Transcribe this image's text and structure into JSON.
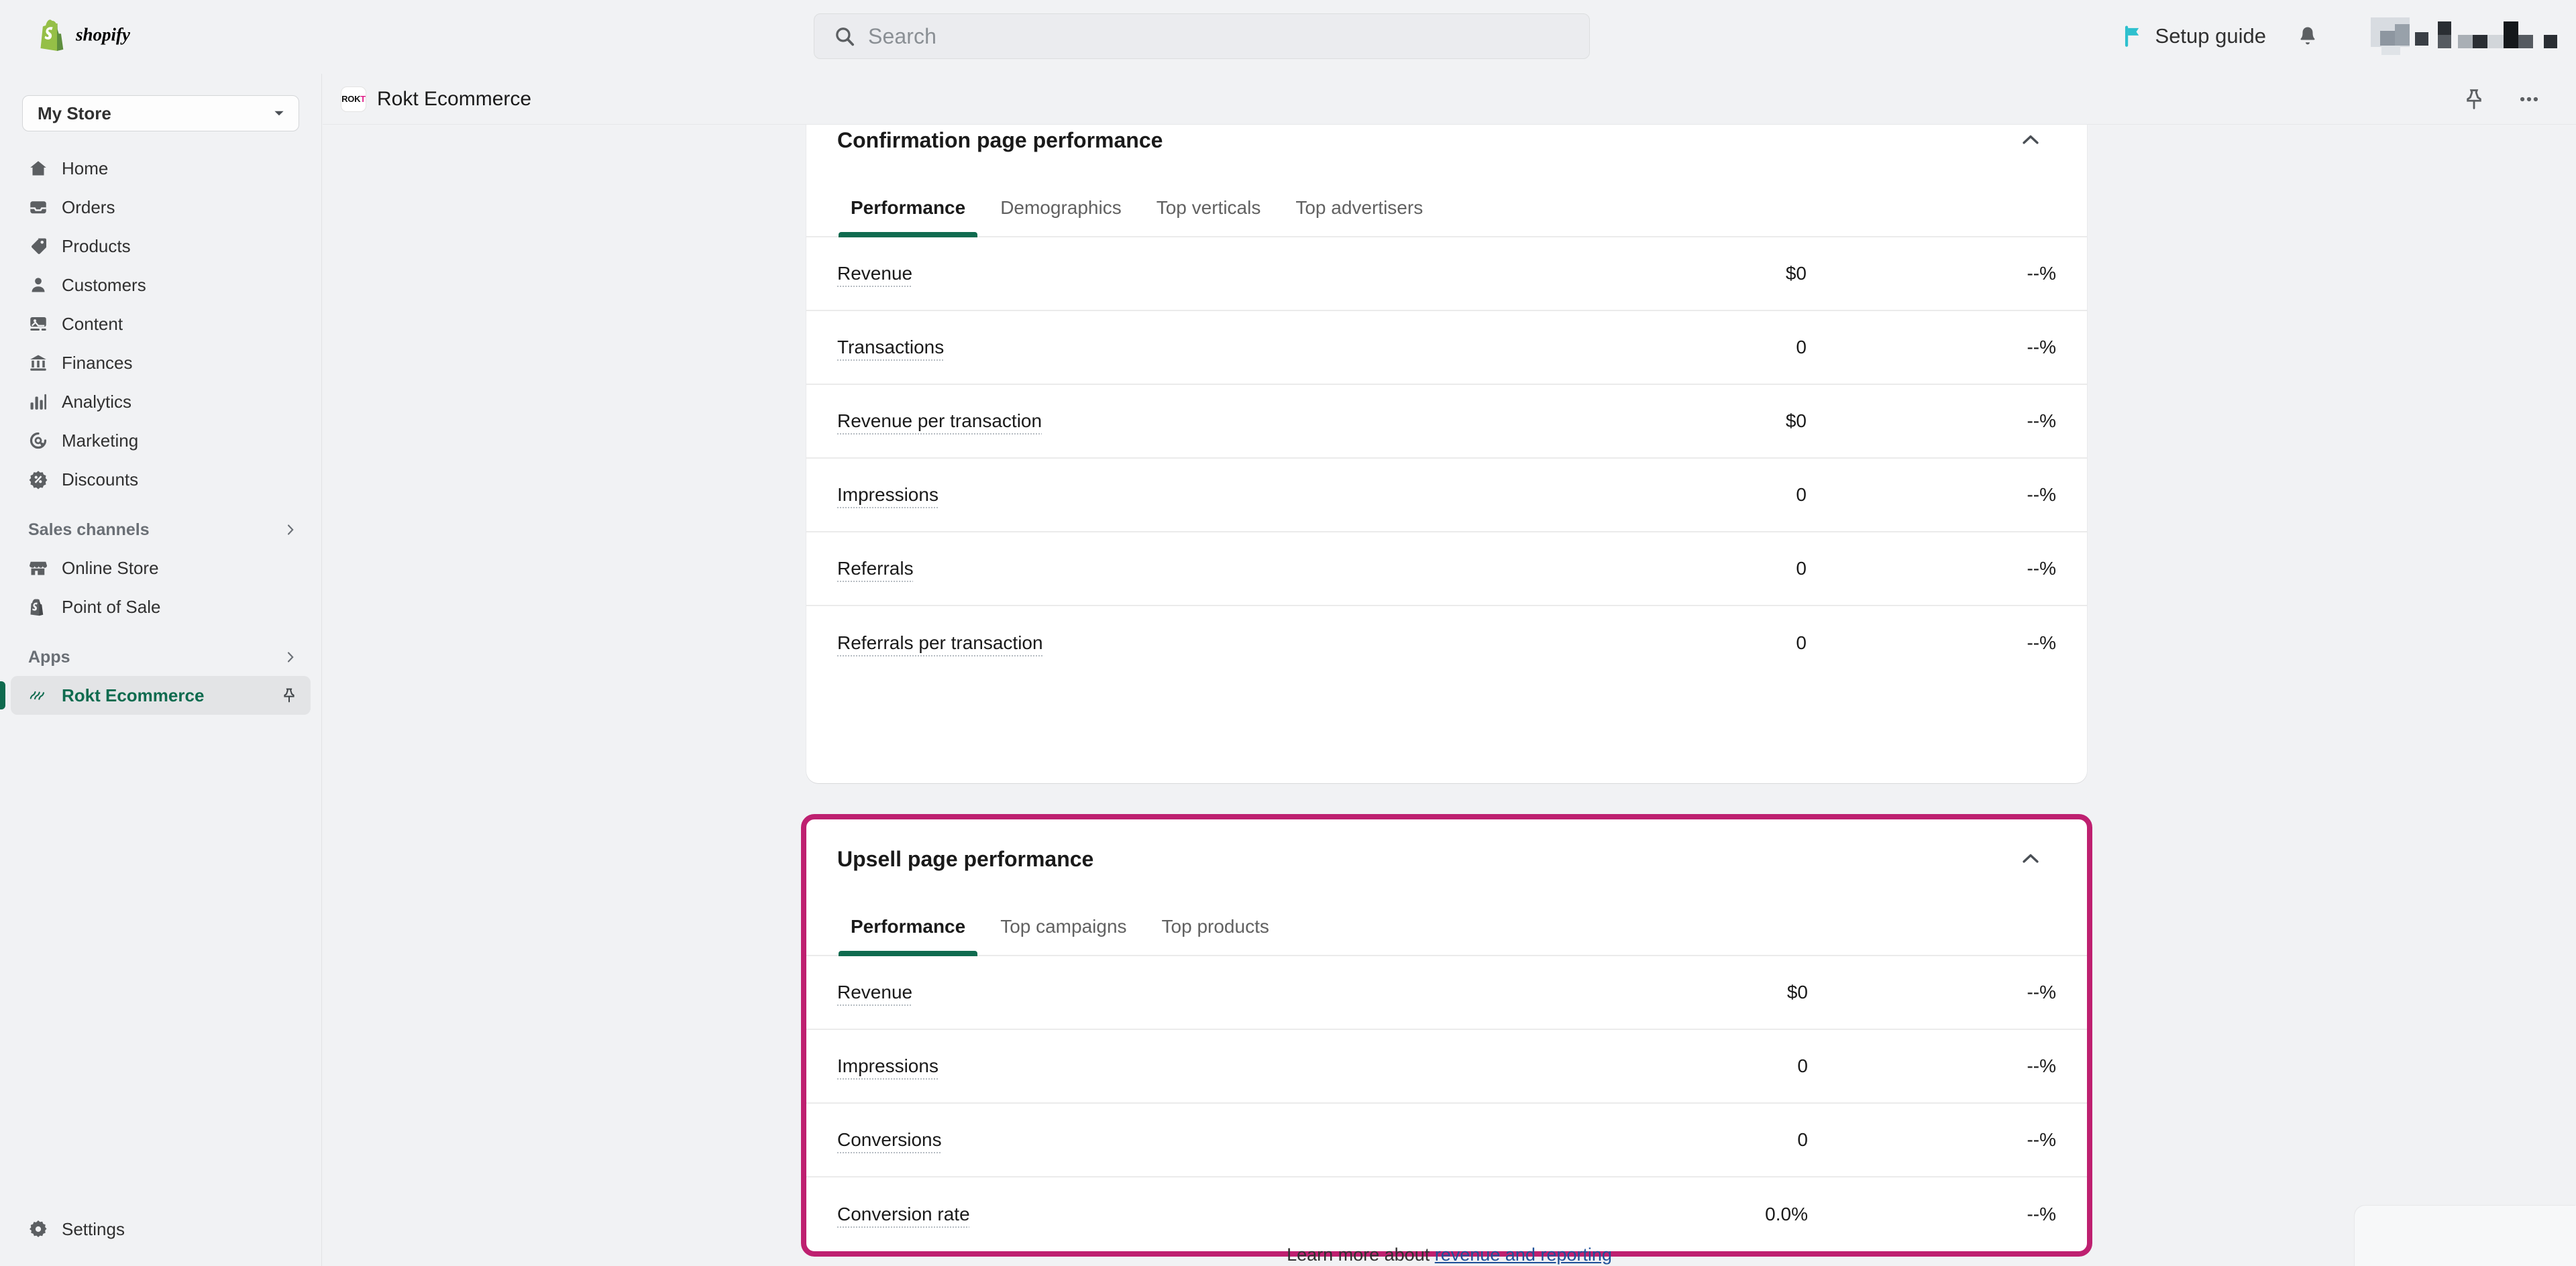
{
  "topbar": {
    "logo_text": "shopify",
    "search": {
      "placeholder": "Search",
      "value": "",
      "icon": "search-icon"
    },
    "setup_guide": {
      "label": "Setup guide",
      "icon": "flag-icon",
      "color": "#2ec0ce"
    },
    "notifications_icon": "bell-icon",
    "store_chip": {
      "label": "",
      "note": "redacted"
    }
  },
  "sidebar": {
    "store_switcher": {
      "label": "My Store",
      "icon": "chevron-down-icon"
    },
    "items": [
      {
        "label": "Home",
        "icon": "home-icon"
      },
      {
        "label": "Orders",
        "icon": "orders-icon"
      },
      {
        "label": "Products",
        "icon": "products-tag-icon"
      },
      {
        "label": "Customers",
        "icon": "customers-person-icon"
      },
      {
        "label": "Content",
        "icon": "content-image-icon"
      },
      {
        "label": "Finances",
        "icon": "finances-bank-icon"
      },
      {
        "label": "Analytics",
        "icon": "analytics-bars-icon"
      },
      {
        "label": "Marketing",
        "icon": "marketing-target-icon"
      },
      {
        "label": "Discounts",
        "icon": "discounts-badge-icon"
      }
    ],
    "sections": [
      {
        "label": "Sales channels",
        "icon": "chevron-right-icon"
      },
      {
        "label": "Apps",
        "icon": "chevron-right-icon"
      }
    ],
    "sales_channels": [
      {
        "label": "Online Store",
        "icon": "storefront-icon"
      },
      {
        "label": "Point of Sale",
        "icon": "pos-bag-icon"
      }
    ],
    "apps": [
      {
        "label": "Rokt Ecommerce",
        "icon": "rokt-squiggle-icon",
        "active": true,
        "pin_icon": "pin-icon"
      }
    ],
    "settings": {
      "label": "Settings",
      "icon": "gear-icon"
    }
  },
  "appbar": {
    "app_name": "Rokt Ecommerce",
    "logo_word": "ROK",
    "logo_word_accent": "T",
    "pin_icon": "pin-icon",
    "more_icon": "more-horizontal-icon"
  },
  "colors": {
    "accent_green": "#0f6b4f",
    "highlight_magenta": "#be2070",
    "link_blue": "#1f5199",
    "teal": "#2ec0ce"
  },
  "cards": [
    {
      "id": "confirmation",
      "title": "Confirmation page performance",
      "collapse_icon": "chevron-up-icon",
      "tabs": [
        {
          "label": "Performance",
          "active": true
        },
        {
          "label": "Demographics",
          "active": false
        },
        {
          "label": "Top verticals",
          "active": false
        },
        {
          "label": "Top advertisers",
          "active": false
        }
      ],
      "metrics": [
        {
          "label": "Revenue",
          "value": "$0",
          "delta": "--%"
        },
        {
          "label": "Transactions",
          "value": "0",
          "delta": "--%"
        },
        {
          "label": "Revenue per transaction",
          "value": "$0",
          "delta": "--%"
        },
        {
          "label": "Impressions",
          "value": "0",
          "delta": "--%"
        },
        {
          "label": "Referrals",
          "value": "0",
          "delta": "--%"
        },
        {
          "label": "Referrals per transaction",
          "value": "0",
          "delta": "--%"
        }
      ]
    },
    {
      "id": "upsell",
      "title": "Upsell page performance",
      "collapse_icon": "chevron-up-icon",
      "highlighted": true,
      "tabs": [
        {
          "label": "Performance",
          "active": true
        },
        {
          "label": "Top campaigns",
          "active": false
        },
        {
          "label": "Top products",
          "active": false
        }
      ],
      "metrics": [
        {
          "label": "Revenue",
          "value": "$0",
          "delta": "--%"
        },
        {
          "label": "Impressions",
          "value": "0",
          "delta": "--%"
        },
        {
          "label": "Conversions",
          "value": "0",
          "delta": "--%"
        },
        {
          "label": "Conversion rate",
          "value": "0.0%",
          "delta": "--%"
        }
      ]
    }
  ],
  "footer": {
    "learn_prefix": "Learn more about ",
    "learn_link": "revenue and reporting"
  }
}
